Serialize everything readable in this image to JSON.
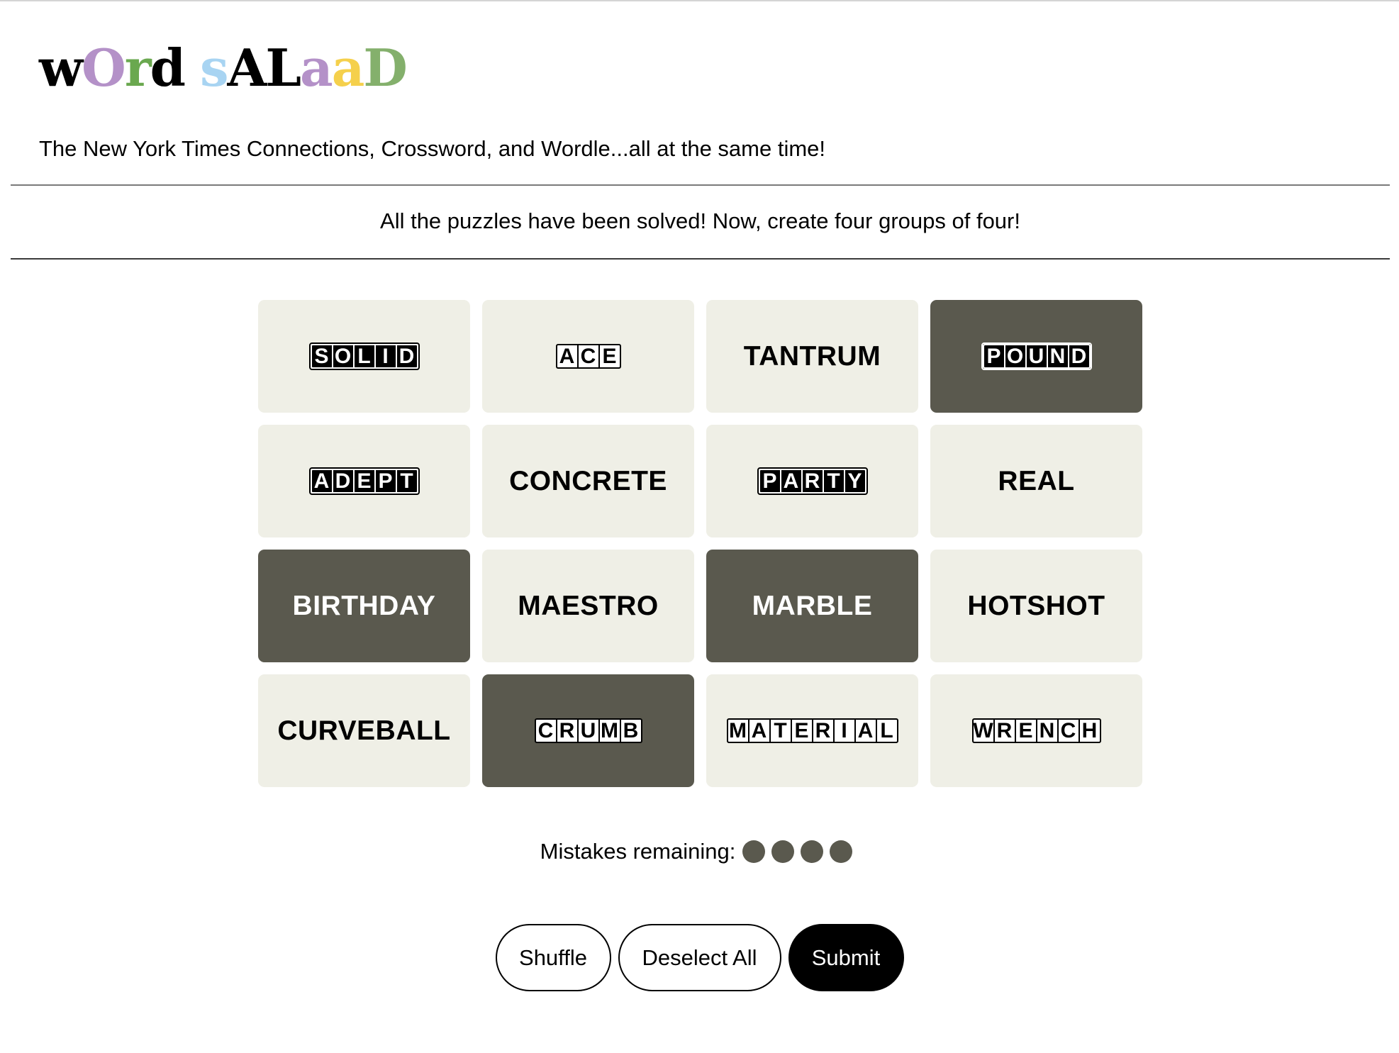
{
  "logo": {
    "letters": [
      {
        "ch": "w",
        "color": "#000000"
      },
      {
        "ch": "O",
        "color": "#b491c8"
      },
      {
        "ch": "r",
        "color": "#6aa84f"
      },
      {
        "ch": "d",
        "color": "#000000"
      },
      {
        "ch": " ",
        "color": "#000000"
      },
      {
        "ch": "s",
        "color": "#a8d4f2"
      },
      {
        "ch": "A",
        "color": "#000000"
      },
      {
        "ch": "L",
        "color": "#000000"
      },
      {
        "ch": "a",
        "color": "#b491c8"
      },
      {
        "ch": "a",
        "color": "#f5d04c"
      },
      {
        "ch": "D",
        "color": "#84b06c"
      }
    ]
  },
  "tagline": "The New York Times Connections, Crossword, and Wordle...all at the same time!",
  "banner": "All the puzzles have been solved! Now, create four groups of four!",
  "tiles": [
    {
      "word": "SOLID",
      "style": "boxes-dark",
      "selected": false
    },
    {
      "word": "ACE",
      "style": "boxes-light",
      "selected": false
    },
    {
      "word": "TANTRUM",
      "style": "plain",
      "selected": false
    },
    {
      "word": "POUND",
      "style": "boxes-dark",
      "selected": true
    },
    {
      "word": "ADEPT",
      "style": "boxes-dark",
      "selected": false
    },
    {
      "word": "CONCRETE",
      "style": "plain",
      "selected": false
    },
    {
      "word": "PARTY",
      "style": "boxes-dark",
      "selected": false
    },
    {
      "word": "REAL",
      "style": "plain",
      "selected": false
    },
    {
      "word": "BIRTHDAY",
      "style": "plain",
      "selected": true
    },
    {
      "word": "MAESTRO",
      "style": "plain",
      "selected": false
    },
    {
      "word": "MARBLE",
      "style": "plain",
      "selected": true
    },
    {
      "word": "HOTSHOT",
      "style": "plain",
      "selected": false
    },
    {
      "word": "CURVEBALL",
      "style": "plain",
      "selected": false
    },
    {
      "word": "CRUMB",
      "style": "boxes-light",
      "selected": true
    },
    {
      "word": "MATERIAL",
      "style": "boxes-light",
      "selected": false
    },
    {
      "word": "WRENCH",
      "style": "boxes-light",
      "selected": false
    }
  ],
  "mistakes": {
    "label": "Mistakes remaining:",
    "remaining": 4
  },
  "buttons": {
    "shuffle": "Shuffle",
    "deselect": "Deselect All",
    "submit": "Submit"
  },
  "colors": {
    "tile_bg": "#efefe6",
    "tile_selected_bg": "#5a594e",
    "dot": "#5a594e"
  }
}
